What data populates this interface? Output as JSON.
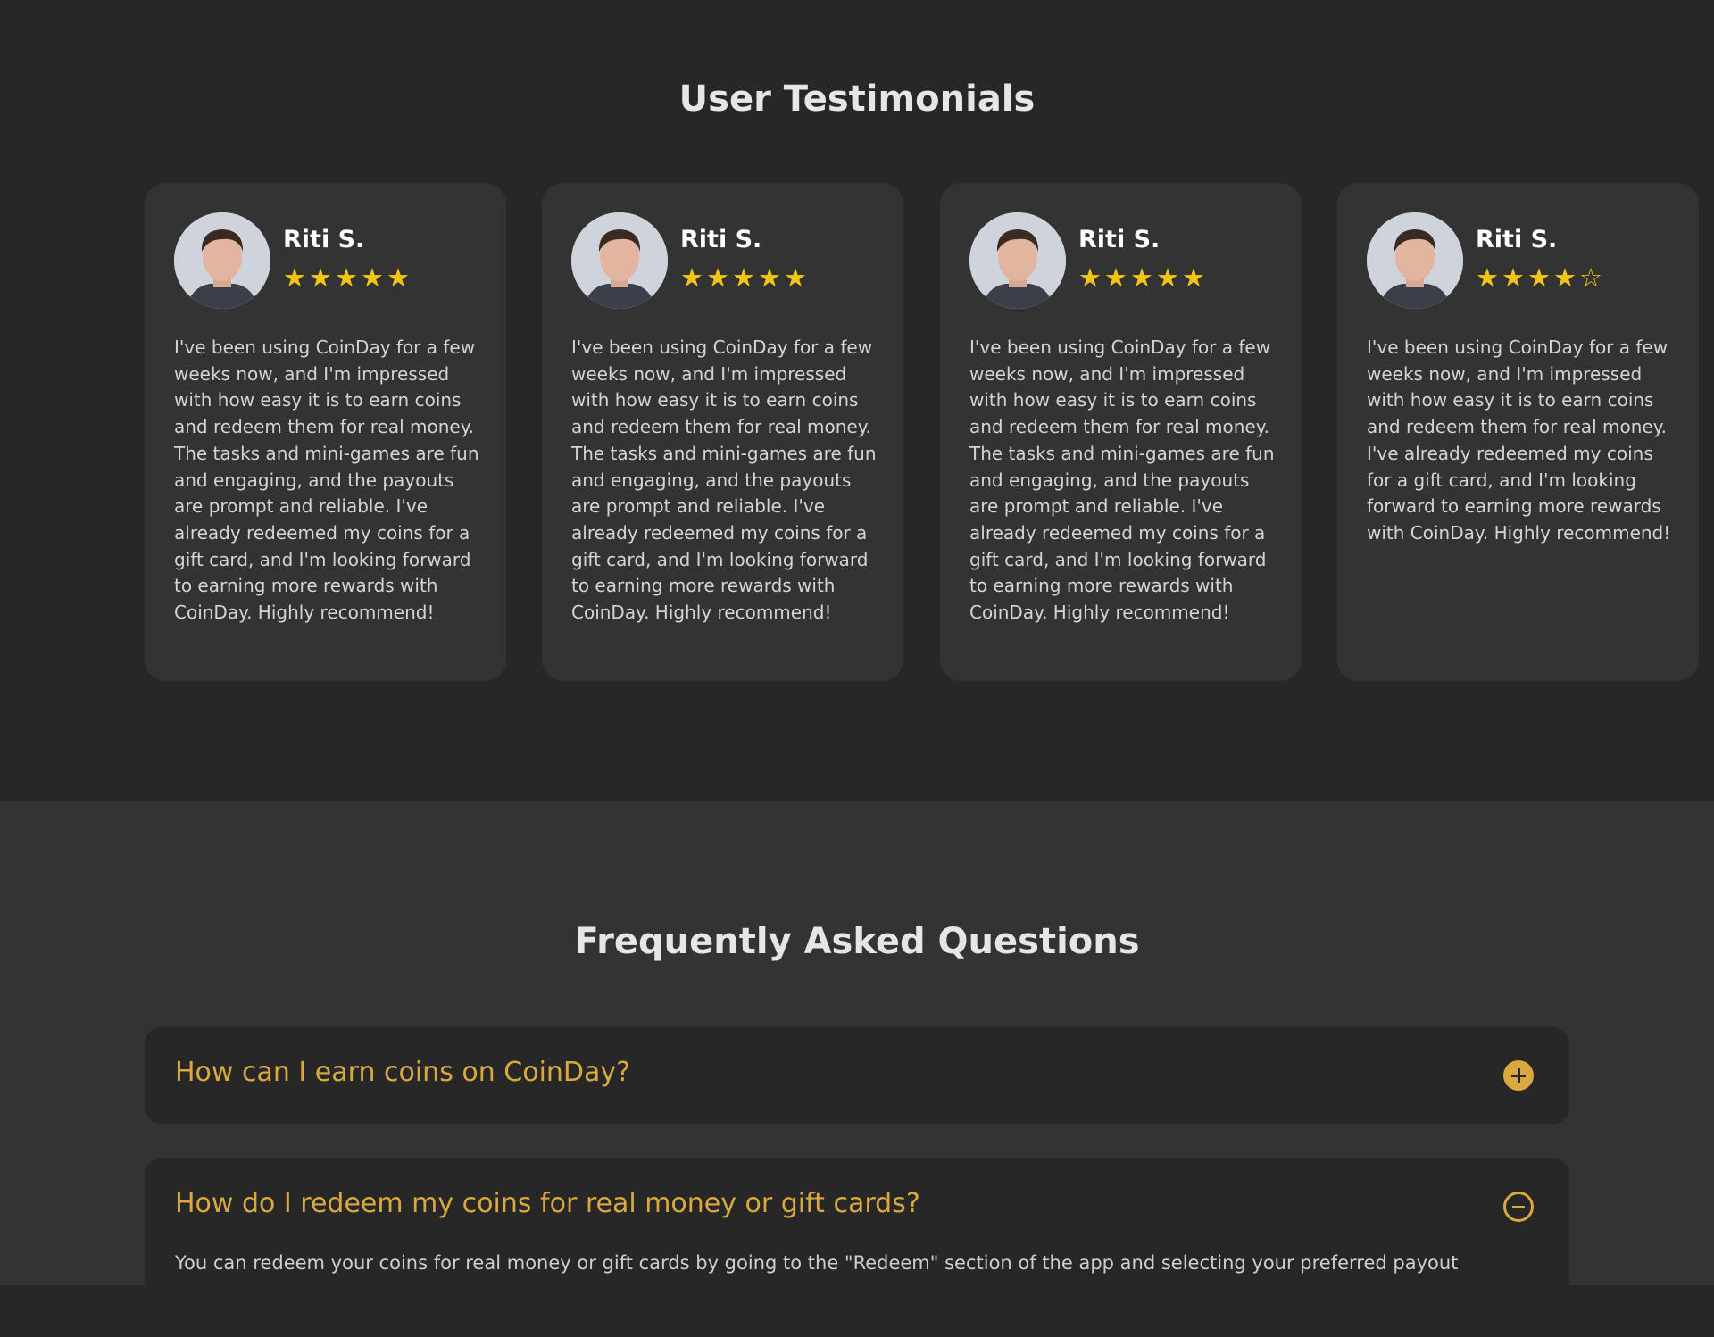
{
  "testimonials": {
    "title": "User Testimonials",
    "cards": [
      {
        "name": "Riti S.",
        "rating": 5,
        "stars": "★★★★★",
        "text": "I've been using CoinDay for a few weeks now, and I'm impressed with how easy it is to earn coins and redeem them for real money. The tasks and mini-games are fun and engaging, and the payouts are prompt and reliable. I've already redeemed my coins for a gift card, and I'm looking forward to earning more rewards with CoinDay. Highly recommend!"
      },
      {
        "name": "Riti S.",
        "rating": 5,
        "stars": "★★★★★",
        "text": "I've been using CoinDay for a few weeks now, and I'm impressed with how easy it is to earn coins and redeem them for real money. The tasks and mini-games are fun and engaging, and the payouts are prompt and reliable. I've already redeemed my coins for a gift card, and I'm looking forward to earning more rewards with CoinDay. Highly recommend!"
      },
      {
        "name": "Riti S.",
        "rating": 5,
        "stars": "★★★★★",
        "text": "I've been using CoinDay for a few weeks now, and I'm impressed with how easy it is to earn coins and redeem them for real money. The tasks and mini-games are fun and engaging, and the payouts are prompt and reliable. I've already redeemed my coins for a gift card, and I'm looking forward to earning more rewards with CoinDay. Highly recommend!"
      },
      {
        "name": "Riti S.",
        "rating": 4,
        "stars": "★★★★☆",
        "text": "I've been using CoinDay for a few weeks now, and I'm impressed with how easy it is to earn coins and redeem them for real money. I've already redeemed my coins for a gift card, and I'm looking forward to earning more rewards with CoinDay. Highly recommend!"
      }
    ]
  },
  "faq": {
    "title": "Frequently Asked Questions",
    "items": [
      {
        "question": "How can I earn coins on CoinDay?",
        "expanded": false,
        "toggle_icon": "plus-circle-icon"
      },
      {
        "question": "How do I redeem my coins for real money or gift cards?",
        "expanded": true,
        "toggle_icon": "minus-circle-icon",
        "answer": "You can redeem your coins for real money or gift cards by going to the \"Redeem\" section of the app and selecting your preferred payout"
      }
    ]
  },
  "colors": {
    "accent": "#d9a93f",
    "star": "#f2c417",
    "page_bg": "#272727",
    "card_bg": "#333333"
  }
}
